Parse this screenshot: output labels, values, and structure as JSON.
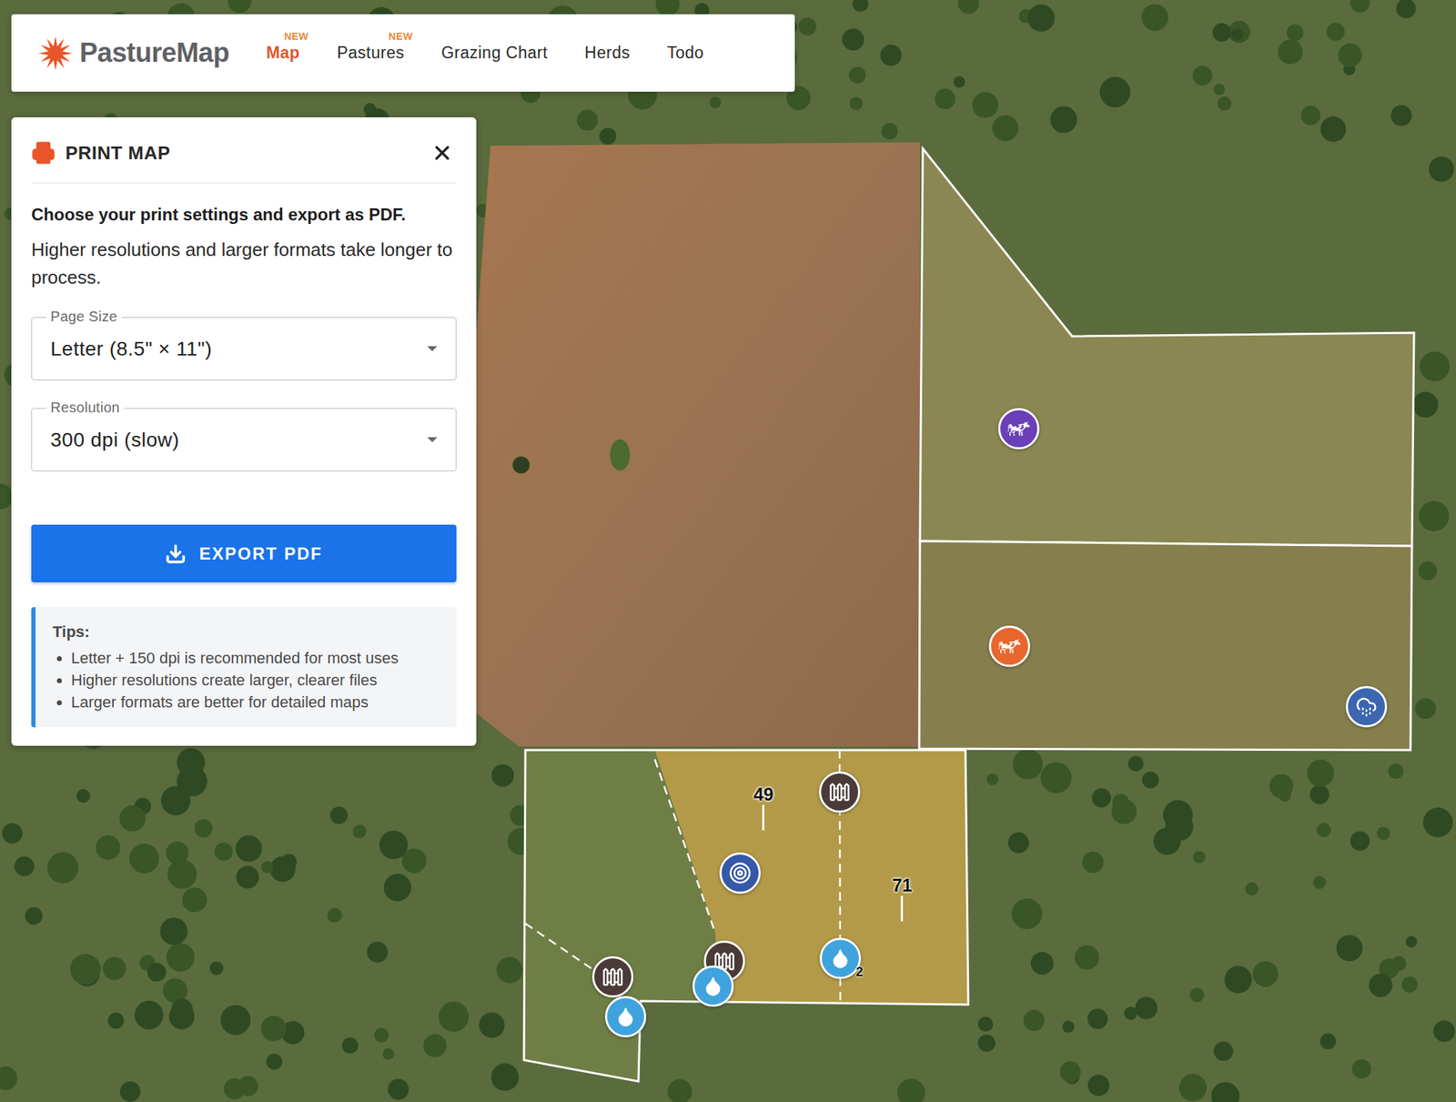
{
  "nav": {
    "logo": "PastureMap",
    "items": [
      {
        "label": "Map",
        "badge": "NEW",
        "selected": true
      },
      {
        "label": "Pastures",
        "badge": "NEW",
        "selected": false
      },
      {
        "label": "Grazing Chart",
        "badge": "",
        "selected": false
      },
      {
        "label": "Herds",
        "badge": "",
        "selected": false
      },
      {
        "label": "Todo",
        "badge": "",
        "selected": false
      }
    ]
  },
  "print_panel": {
    "title": "PRINT MAP",
    "heading": "Choose your print settings and export as PDF.",
    "description": "Higher resolutions and larger formats take longer to process.",
    "fields": [
      {
        "label": "Page Size",
        "value": "Letter (8.5\" × 11\")"
      },
      {
        "label": "Resolution",
        "value": "300 dpi (slow)"
      }
    ],
    "button": "EXPORT PDF",
    "tips": {
      "title": "Tips:",
      "items": [
        "Letter + 150 dpi is recommended for most uses",
        "Higher resolutions create larger, clearer files",
        "Larger formats are better for detailed maps"
      ]
    }
  },
  "map": {
    "pins": [
      {
        "kind": "herd",
        "color": "#6b3fb8"
      },
      {
        "kind": "herd",
        "color": "#e9662c"
      },
      {
        "kind": "rain"
      },
      {
        "kind": "gate"
      },
      {
        "kind": "label",
        "text": "49"
      },
      {
        "kind": "target"
      },
      {
        "kind": "label",
        "text": "71"
      },
      {
        "kind": "gate"
      },
      {
        "kind": "water",
        "count": "2"
      },
      {
        "kind": "gate"
      },
      {
        "kind": "water"
      },
      {
        "kind": "water"
      }
    ]
  }
}
